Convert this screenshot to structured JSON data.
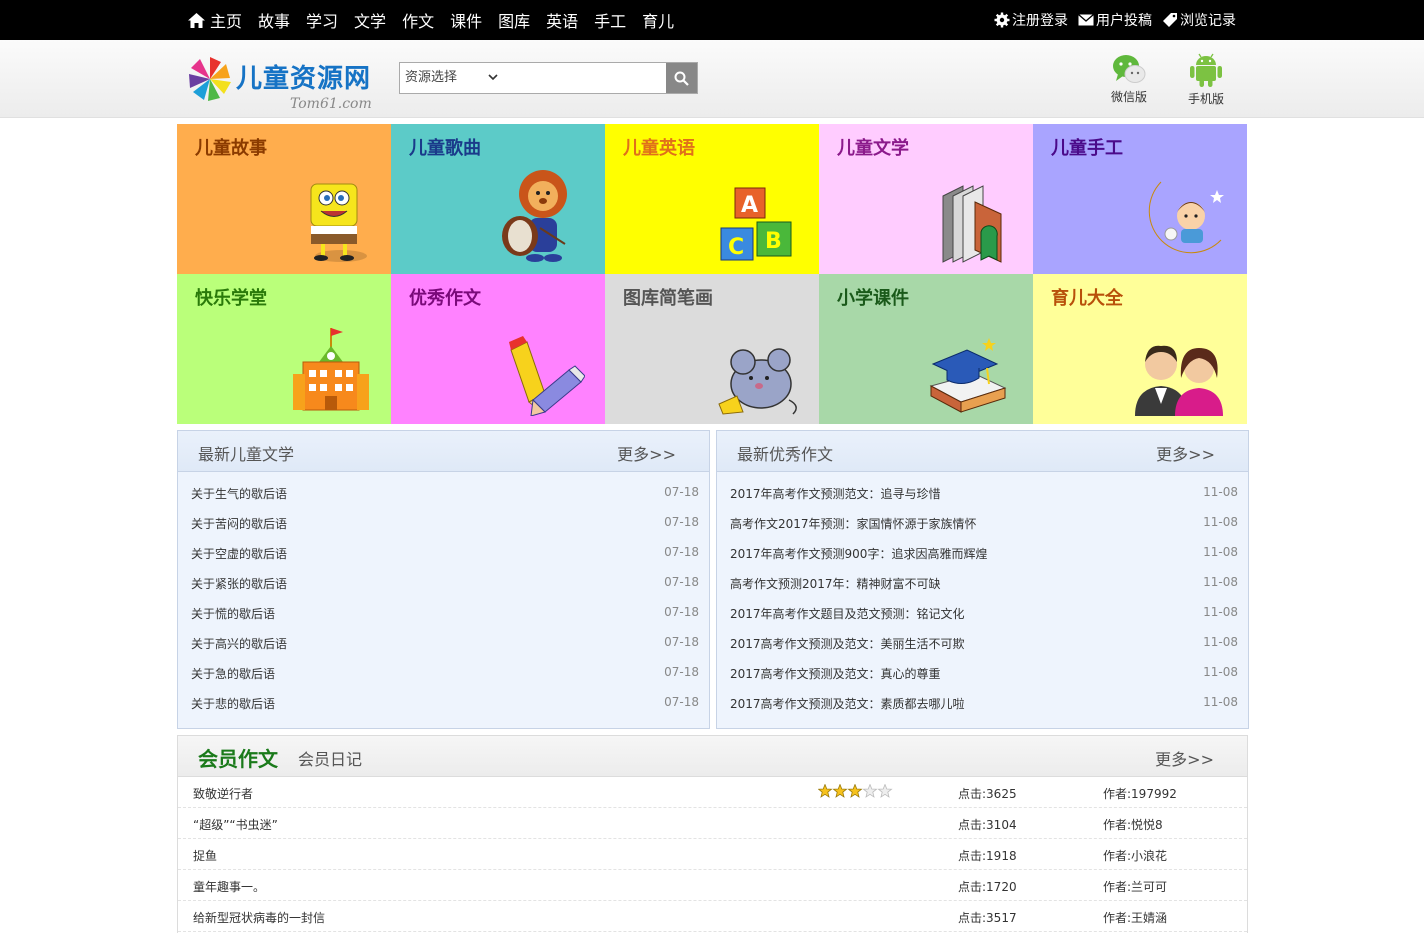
{
  "nav": {
    "home": "主页",
    "items": [
      "故事",
      "学习",
      "文学",
      "作文",
      "课件",
      "图库",
      "英语",
      "手工",
      "育儿"
    ],
    "login": "注册登录",
    "submit": "用户投稿",
    "history": "浏览记录"
  },
  "header": {
    "logo_name": "儿童资源网",
    "logo_sub": "Tom61.com",
    "search_select": "资源选择",
    "search_value": "",
    "wechat_label": "微信版",
    "mobile_label": "手机版"
  },
  "categories": [
    {
      "title": "儿童故事",
      "bg": "#ffad4d",
      "color": "#8b3b00"
    },
    {
      "title": "儿童歌曲",
      "bg": "#5ccbc8",
      "color": "#1a3a8a"
    },
    {
      "title": "儿童英语",
      "bg": "#ffff00",
      "color": "#e0701a"
    },
    {
      "title": "儿童文学",
      "bg": "#ffccff",
      "color": "#8b1a8b"
    },
    {
      "title": "儿童手工",
      "bg": "#a9a4ff",
      "color": "#4a0a8a"
    },
    {
      "title": "快乐学堂",
      "bg": "#baff7a",
      "color": "#2a7a0a"
    },
    {
      "title": "优秀作文",
      "bg": "#ff82ff",
      "color": "#7a0a7a"
    },
    {
      "title": "图库简笔画",
      "bg": "#dcdcdc",
      "color": "#555555"
    },
    {
      "title": "小学课件",
      "bg": "#a8d8a8",
      "color": "#1a5a1a"
    },
    {
      "title": "育儿大全",
      "bg": "#ffff99",
      "color": "#b8500a"
    }
  ],
  "panel_left": {
    "title": "最新儿童文学",
    "more": "更多>>",
    "items": [
      {
        "text": "关于生气的歇后语",
        "date": "07-18"
      },
      {
        "text": "关于苦闷的歇后语",
        "date": "07-18"
      },
      {
        "text": "关于空虚的歇后语",
        "date": "07-18"
      },
      {
        "text": "关于紧张的歇后语",
        "date": "07-18"
      },
      {
        "text": "关于慌的歇后语",
        "date": "07-18"
      },
      {
        "text": "关于高兴的歇后语",
        "date": "07-18"
      },
      {
        "text": "关于急的歇后语",
        "date": "07-18"
      },
      {
        "text": "关于悲的歇后语",
        "date": "07-18"
      }
    ]
  },
  "panel_right": {
    "title": "最新优秀作文",
    "more": "更多>>",
    "items": [
      {
        "text": "2017年高考作文预测范文：追寻与珍惜",
        "date": "11-08"
      },
      {
        "text": "高考作文2017年预测：家国情怀源于家族情怀",
        "date": "11-08"
      },
      {
        "text": "2017年高考作文预测900字：追求因高雅而辉煌",
        "date": "11-08"
      },
      {
        "text": "高考作文预测2017年：精神财富不可缺",
        "date": "11-08"
      },
      {
        "text": "2017年高考作文题目及范文预测：铭记文化",
        "date": "11-08"
      },
      {
        "text": "2017高考作文预测及范文：美丽生活不可欺",
        "date": "11-08"
      },
      {
        "text": "2017高考作文预测及范文：真心的尊重",
        "date": "11-08"
      },
      {
        "text": "2017高考作文预测及范文：素质都去哪儿啦",
        "date": "11-08"
      }
    ]
  },
  "member": {
    "tab_active": "会员作文",
    "tab_other": "会员日记",
    "more": "更多>>",
    "rows": [
      {
        "title": "致敬逆行者",
        "stars": 3,
        "hits": "点击:3625",
        "author": "作者:197992"
      },
      {
        "title": "“超级”“书虫迷”",
        "stars": 0,
        "hits": "点击:3104",
        "author": "作者:悦悦8"
      },
      {
        "title": "捉鱼",
        "stars": 0,
        "hits": "点击:1918",
        "author": "作者:小浪花"
      },
      {
        "title": "童年趣事一。",
        "stars": 0,
        "hits": "点击:1720",
        "author": "作者:兰可可"
      },
      {
        "title": "给新型冠状病毒的一封信",
        "stars": 0,
        "hits": "点击:3517",
        "author": "作者:王婧涵"
      }
    ]
  }
}
